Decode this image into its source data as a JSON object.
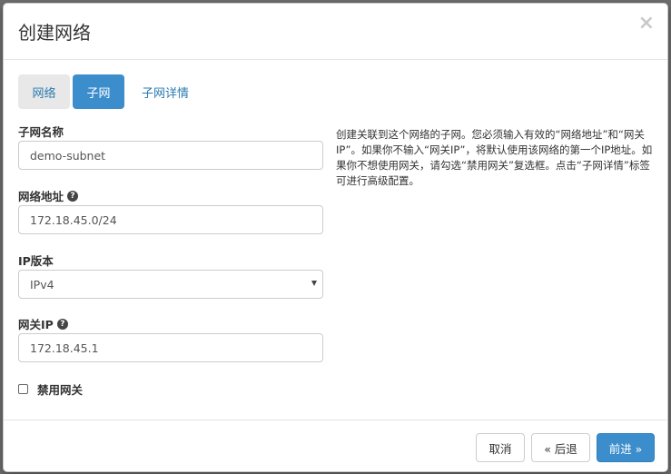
{
  "modal": {
    "title": "创建网络",
    "close_glyph": "×"
  },
  "tabs": [
    {
      "label": "网络"
    },
    {
      "label": "子网"
    },
    {
      "label": "子网详情"
    }
  ],
  "form": {
    "subnet_name": {
      "label": "子网名称",
      "value": "demo-subnet"
    },
    "network_address": {
      "label": "网络地址",
      "value": "172.18.45.0/24",
      "help_glyph": "?"
    },
    "ip_version": {
      "label": "IP版本",
      "value": "IPv4"
    },
    "gateway_ip": {
      "label": "网关IP",
      "value": "172.18.45.1",
      "help_glyph": "?"
    },
    "disable_gateway": {
      "label": "禁用网关",
      "checked": false
    }
  },
  "help_text": "创建关联到这个网络的子网。您必须输入有效的“网络地址”和“网关IP”。如果你不输入“网关IP”，将默认使用该网络的第一个IP地址。如果你不想使用网关，请勾选“禁用网关”复选框。点击“子网详情”标签可进行高级配置。",
  "footer": {
    "cancel_label": "取消",
    "back_label": "« 后退",
    "next_label": "前进 »"
  },
  "colors": {
    "primary": "#3c8dcb",
    "link": "#2a7ab0"
  }
}
